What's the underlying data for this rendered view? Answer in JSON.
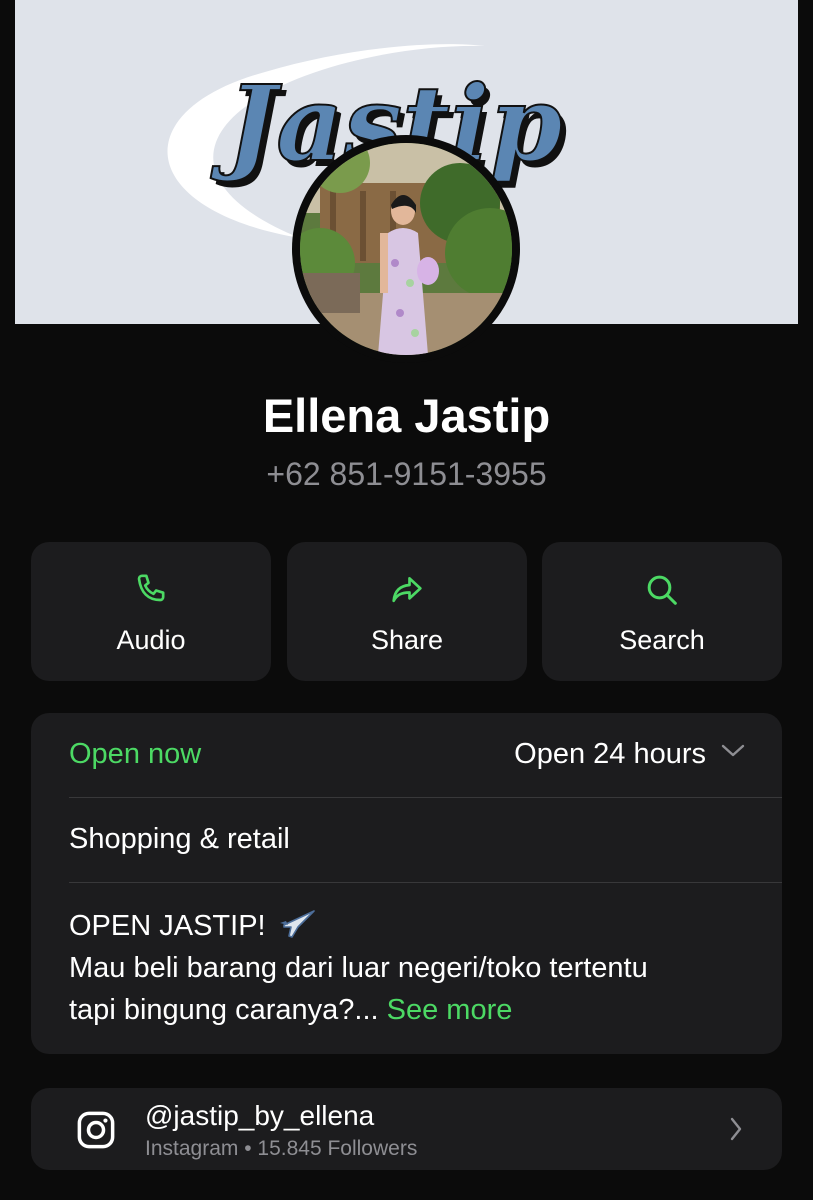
{
  "cover": {
    "logo_text": "Jastip"
  },
  "profile": {
    "name": "Ellena Jastip",
    "phone": "+62 851-9151-3955"
  },
  "actions": [
    {
      "label": "Audio",
      "icon": "phone-icon"
    },
    {
      "label": "Share",
      "icon": "share-arrow-icon"
    },
    {
      "label": "Search",
      "icon": "search-icon"
    }
  ],
  "business": {
    "status": "Open now",
    "hours": "Open 24 hours",
    "category": "Shopping & retail",
    "description_line1": "OPEN JASTIP!",
    "description_line2": "Mau beli barang dari luar negeri/toko tertentu",
    "description_line3": "tapi bingung caranya?...",
    "see_more": "See more"
  },
  "instagram": {
    "handle": "@jastip_by_ellena",
    "subtitle": "Instagram • 15.845 Followers"
  },
  "colors": {
    "accent": "#4cd964",
    "card": "#1c1c1e",
    "background": "#0b0b0b",
    "secondary_text": "#8e8e93",
    "cover": "#dfe3ea",
    "logo": "#5b86b3"
  }
}
